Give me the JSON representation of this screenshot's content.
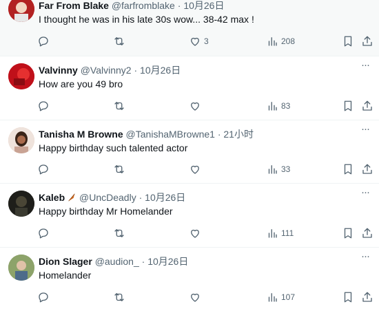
{
  "replies": [
    {
      "name": "Far From Blake",
      "handle": "@farfromblake",
      "dot": "·",
      "time": "10月26日",
      "text": "I thought he was in his late 30s wow... 38-42 max !",
      "likes": "3",
      "views": "208",
      "avatar_color": "#b22222"
    },
    {
      "name": "Valvinny",
      "handle": "@Valvinny2",
      "dot": "·",
      "time": "10月26日",
      "text": "How are you 49 bro",
      "likes": "",
      "views": "83",
      "avatar_color": "#c0101a"
    },
    {
      "name": "Tanisha M Browne",
      "handle": "@TanishaMBrowne1",
      "dot": "·",
      "time": "21小时",
      "text": "Happy birthday such talented actor",
      "likes": "",
      "views": "33",
      "avatar_color": "#d9b8a8"
    },
    {
      "name": "Kaleb",
      "handle": "@UncDeadly",
      "dot": "·",
      "time": "10月26日",
      "text": "Happy birthday Mr Homelander",
      "likes": "",
      "views": "111",
      "avatar_color": "#2a2a22"
    },
    {
      "name": "Dion Slager",
      "handle": "@audion_",
      "dot": "·",
      "time": "10月26日",
      "text": "Homelander",
      "likes": "",
      "views": "107",
      "avatar_color": "#7b8f5a"
    }
  ],
  "icons": {
    "reply": "reply-icon",
    "retweet": "retweet-icon",
    "like": "like-icon",
    "views": "views-icon",
    "bookmark": "bookmark-icon",
    "share": "share-icon",
    "more": "more-icon",
    "badge": "feather-emoji-icon"
  },
  "colors": {
    "text": "#0f1419",
    "secondary": "#536471",
    "divider": "#eff3f4",
    "hover_bg": "#f7f9f9"
  }
}
